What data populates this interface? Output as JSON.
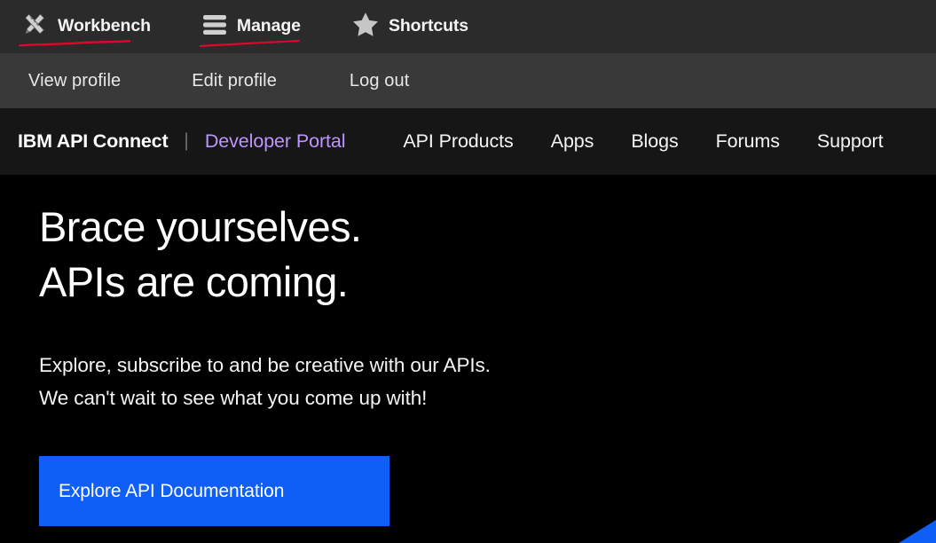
{
  "admin_toolbar": {
    "background": "#2b2b2b",
    "underline_color": "#e2062c",
    "items": [
      {
        "label": "Workbench",
        "icon": "tools-icon",
        "underlined": true
      },
      {
        "label": "Manage",
        "icon": "hamburger-menu-icon",
        "underlined": true
      },
      {
        "label": "Shortcuts",
        "icon": "star-icon",
        "underlined": false
      }
    ]
  },
  "profile_bar": {
    "background": "#393939",
    "links": [
      {
        "label": "View profile"
      },
      {
        "label": "Edit profile"
      },
      {
        "label": "Log out"
      }
    ]
  },
  "portal_nav": {
    "background": "#161616",
    "brand": "IBM API Connect",
    "divider": "|",
    "portal_name": "Developer Portal",
    "portal_name_color": "#be95ff",
    "links": [
      {
        "label": "API Products"
      },
      {
        "label": "Apps"
      },
      {
        "label": "Blogs"
      },
      {
        "label": "Forums"
      },
      {
        "label": "Support"
      }
    ]
  },
  "hero": {
    "background": "#000000",
    "heading_line_1": "Brace yourselves.",
    "heading_line_2": "APIs are coming.",
    "body_line_1": "Explore, subscribe to and be creative with our APIs.",
    "body_line_2": "We can't wait to see what you come up with!",
    "cta_label": "Explore API Documentation",
    "cta_color": "#0f5ef7",
    "corner_accent_color": "#0f5ef7"
  }
}
